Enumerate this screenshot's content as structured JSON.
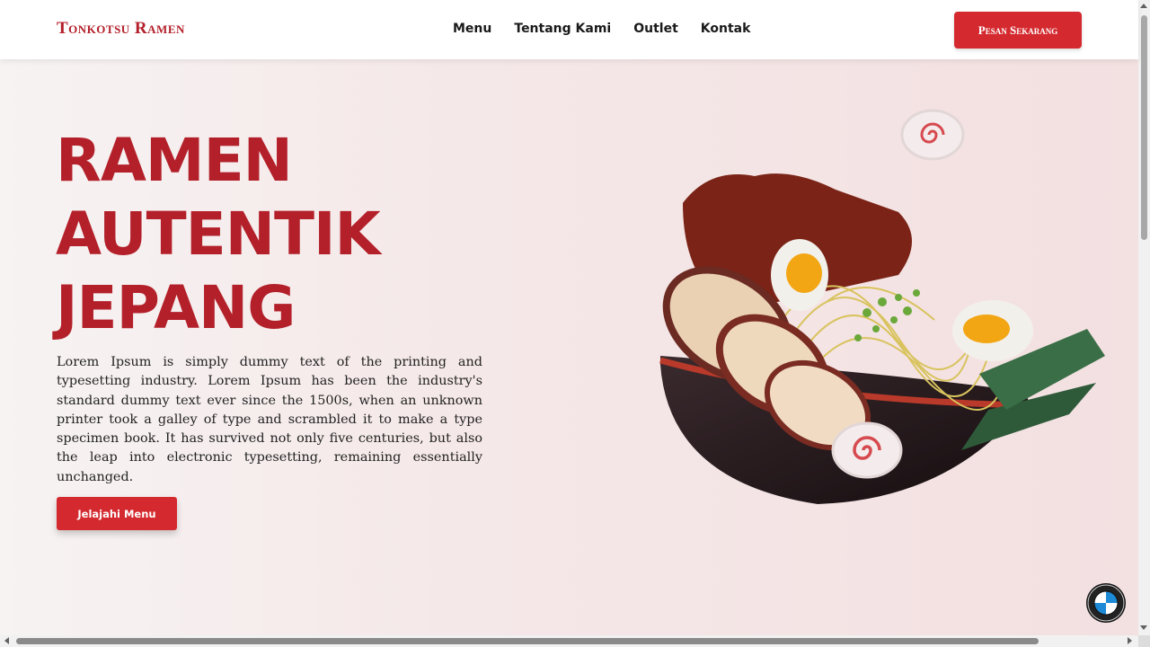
{
  "brand": {
    "name": "Tonkotsu Ramen",
    "color": "#b3202a",
    "accent": "#d42a2f"
  },
  "nav": {
    "items": [
      "Menu",
      "Tentang Kami",
      "Outlet",
      "Kontak"
    ]
  },
  "header": {
    "cta_label": "Pesan Sekarang"
  },
  "hero": {
    "title_lines": [
      "RAMEN",
      "AUTENTIK",
      "JEPANG"
    ],
    "description": "Lorem Ipsum is simply dummy text of the printing and typesetting industry. Lorem Ipsum has been the industry's standard dummy text ever since the 1500s, when an unknown printer took a galley of type and scrambled it to make a type specimen book. It has survived not only five centuries, but also the leap into electronic typesetting, remaining essentially unchanged.",
    "button_label": "Jelajahi Menu",
    "image_icon": "ramen-bowl-illustration"
  },
  "floating_badge": {
    "icon": "bmw-logo-icon"
  }
}
